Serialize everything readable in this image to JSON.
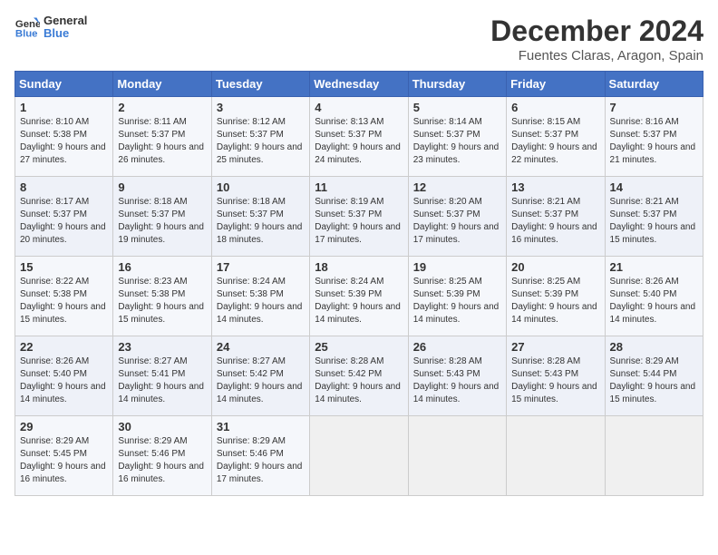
{
  "header": {
    "logo_general": "General",
    "logo_blue": "Blue",
    "month_title": "December 2024",
    "location": "Fuentes Claras, Aragon, Spain"
  },
  "days_of_week": [
    "Sunday",
    "Monday",
    "Tuesday",
    "Wednesday",
    "Thursday",
    "Friday",
    "Saturday"
  ],
  "weeks": [
    [
      {
        "day": "1",
        "sunrise": "Sunrise: 8:10 AM",
        "sunset": "Sunset: 5:38 PM",
        "daylight": "Daylight: 9 hours and 27 minutes."
      },
      {
        "day": "2",
        "sunrise": "Sunrise: 8:11 AM",
        "sunset": "Sunset: 5:37 PM",
        "daylight": "Daylight: 9 hours and 26 minutes."
      },
      {
        "day": "3",
        "sunrise": "Sunrise: 8:12 AM",
        "sunset": "Sunset: 5:37 PM",
        "daylight": "Daylight: 9 hours and 25 minutes."
      },
      {
        "day": "4",
        "sunrise": "Sunrise: 8:13 AM",
        "sunset": "Sunset: 5:37 PM",
        "daylight": "Daylight: 9 hours and 24 minutes."
      },
      {
        "day": "5",
        "sunrise": "Sunrise: 8:14 AM",
        "sunset": "Sunset: 5:37 PM",
        "daylight": "Daylight: 9 hours and 23 minutes."
      },
      {
        "day": "6",
        "sunrise": "Sunrise: 8:15 AM",
        "sunset": "Sunset: 5:37 PM",
        "daylight": "Daylight: 9 hours and 22 minutes."
      },
      {
        "day": "7",
        "sunrise": "Sunrise: 8:16 AM",
        "sunset": "Sunset: 5:37 PM",
        "daylight": "Daylight: 9 hours and 21 minutes."
      }
    ],
    [
      {
        "day": "8",
        "sunrise": "Sunrise: 8:17 AM",
        "sunset": "Sunset: 5:37 PM",
        "daylight": "Daylight: 9 hours and 20 minutes."
      },
      {
        "day": "9",
        "sunrise": "Sunrise: 8:18 AM",
        "sunset": "Sunset: 5:37 PM",
        "daylight": "Daylight: 9 hours and 19 minutes."
      },
      {
        "day": "10",
        "sunrise": "Sunrise: 8:18 AM",
        "sunset": "Sunset: 5:37 PM",
        "daylight": "Daylight: 9 hours and 18 minutes."
      },
      {
        "day": "11",
        "sunrise": "Sunrise: 8:19 AM",
        "sunset": "Sunset: 5:37 PM",
        "daylight": "Daylight: 9 hours and 17 minutes."
      },
      {
        "day": "12",
        "sunrise": "Sunrise: 8:20 AM",
        "sunset": "Sunset: 5:37 PM",
        "daylight": "Daylight: 9 hours and 17 minutes."
      },
      {
        "day": "13",
        "sunrise": "Sunrise: 8:21 AM",
        "sunset": "Sunset: 5:37 PM",
        "daylight": "Daylight: 9 hours and 16 minutes."
      },
      {
        "day": "14",
        "sunrise": "Sunrise: 8:21 AM",
        "sunset": "Sunset: 5:37 PM",
        "daylight": "Daylight: 9 hours and 15 minutes."
      }
    ],
    [
      {
        "day": "15",
        "sunrise": "Sunrise: 8:22 AM",
        "sunset": "Sunset: 5:38 PM",
        "daylight": "Daylight: 9 hours and 15 minutes."
      },
      {
        "day": "16",
        "sunrise": "Sunrise: 8:23 AM",
        "sunset": "Sunset: 5:38 PM",
        "daylight": "Daylight: 9 hours and 15 minutes."
      },
      {
        "day": "17",
        "sunrise": "Sunrise: 8:24 AM",
        "sunset": "Sunset: 5:38 PM",
        "daylight": "Daylight: 9 hours and 14 minutes."
      },
      {
        "day": "18",
        "sunrise": "Sunrise: 8:24 AM",
        "sunset": "Sunset: 5:39 PM",
        "daylight": "Daylight: 9 hours and 14 minutes."
      },
      {
        "day": "19",
        "sunrise": "Sunrise: 8:25 AM",
        "sunset": "Sunset: 5:39 PM",
        "daylight": "Daylight: 9 hours and 14 minutes."
      },
      {
        "day": "20",
        "sunrise": "Sunrise: 8:25 AM",
        "sunset": "Sunset: 5:39 PM",
        "daylight": "Daylight: 9 hours and 14 minutes."
      },
      {
        "day": "21",
        "sunrise": "Sunrise: 8:26 AM",
        "sunset": "Sunset: 5:40 PM",
        "daylight": "Daylight: 9 hours and 14 minutes."
      }
    ],
    [
      {
        "day": "22",
        "sunrise": "Sunrise: 8:26 AM",
        "sunset": "Sunset: 5:40 PM",
        "daylight": "Daylight: 9 hours and 14 minutes."
      },
      {
        "day": "23",
        "sunrise": "Sunrise: 8:27 AM",
        "sunset": "Sunset: 5:41 PM",
        "daylight": "Daylight: 9 hours and 14 minutes."
      },
      {
        "day": "24",
        "sunrise": "Sunrise: 8:27 AM",
        "sunset": "Sunset: 5:42 PM",
        "daylight": "Daylight: 9 hours and 14 minutes."
      },
      {
        "day": "25",
        "sunrise": "Sunrise: 8:28 AM",
        "sunset": "Sunset: 5:42 PM",
        "daylight": "Daylight: 9 hours and 14 minutes."
      },
      {
        "day": "26",
        "sunrise": "Sunrise: 8:28 AM",
        "sunset": "Sunset: 5:43 PM",
        "daylight": "Daylight: 9 hours and 14 minutes."
      },
      {
        "day": "27",
        "sunrise": "Sunrise: 8:28 AM",
        "sunset": "Sunset: 5:43 PM",
        "daylight": "Daylight: 9 hours and 15 minutes."
      },
      {
        "day": "28",
        "sunrise": "Sunrise: 8:29 AM",
        "sunset": "Sunset: 5:44 PM",
        "daylight": "Daylight: 9 hours and 15 minutes."
      }
    ],
    [
      {
        "day": "29",
        "sunrise": "Sunrise: 8:29 AM",
        "sunset": "Sunset: 5:45 PM",
        "daylight": "Daylight: 9 hours and 16 minutes."
      },
      {
        "day": "30",
        "sunrise": "Sunrise: 8:29 AM",
        "sunset": "Sunset: 5:46 PM",
        "daylight": "Daylight: 9 hours and 16 minutes."
      },
      {
        "day": "31",
        "sunrise": "Sunrise: 8:29 AM",
        "sunset": "Sunset: 5:46 PM",
        "daylight": "Daylight: 9 hours and 17 minutes."
      },
      null,
      null,
      null,
      null
    ]
  ]
}
